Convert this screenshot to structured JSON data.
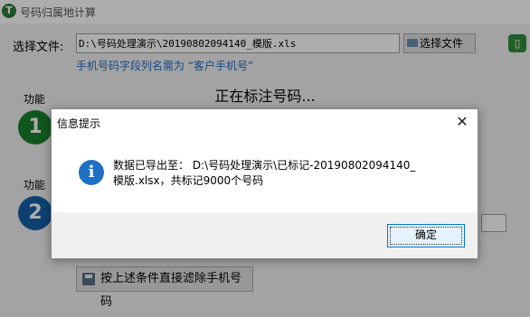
{
  "app": {
    "title": "号码归属地计算",
    "file_label": "选择文件:",
    "file_path": "D:\\号码处理演示\\20190802094140_模版.xls",
    "browse_label": "选择文件",
    "hint": "手机号码字段列名需为 “客户手机号”",
    "status": "正在标注号码...",
    "function1_label": "功能",
    "function1_number": "1",
    "function2_label": "功能",
    "function2_number": "2",
    "filter_button_label": "按上述条件直接滤除手机号码"
  },
  "dialog": {
    "title": "信息提示",
    "close_symbol": "✕",
    "icon_glyph": "i",
    "message": "数据已导出至： D:\\号码处理演示\\已标记-20190802094140_模版.xlsx，共标记9000个号码",
    "ok_label": "确定"
  },
  "colors": {
    "accent": "#0078d7",
    "info_icon": "#1f6fc5",
    "function1": "#1a7f2e",
    "function2": "#1460a8",
    "hint": "#1c6cc9"
  },
  "icons": {
    "app": "app-logo-icon",
    "browse": "folder-icon",
    "filter": "save-disk-icon",
    "info": "info-icon",
    "close": "close-icon"
  }
}
